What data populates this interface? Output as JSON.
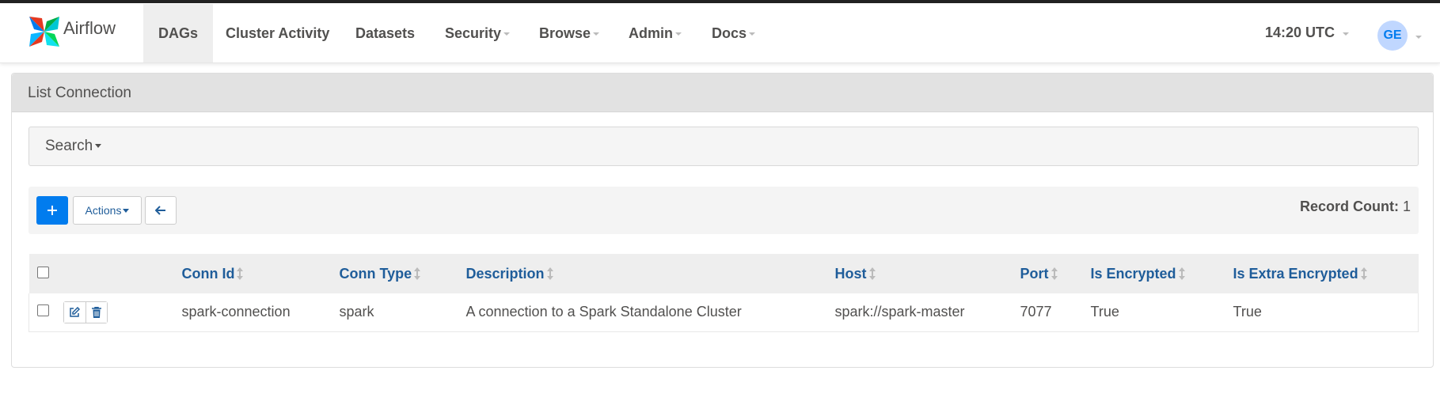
{
  "brand": {
    "name": "Airflow"
  },
  "nav": {
    "items": [
      {
        "label": "DAGs",
        "dropdown": false,
        "active": true
      },
      {
        "label": "Cluster Activity",
        "dropdown": false
      },
      {
        "label": "Datasets",
        "dropdown": false
      },
      {
        "label": "Security",
        "dropdown": true
      },
      {
        "label": "Browse",
        "dropdown": true
      },
      {
        "label": "Admin",
        "dropdown": true
      },
      {
        "label": "Docs",
        "dropdown": true
      }
    ],
    "clock": "14:20 UTC",
    "user_initials": "GE"
  },
  "panel": {
    "title": "List Connection",
    "search_label": "Search",
    "actions_label": "Actions",
    "record_count_label": "Record Count:",
    "record_count": "1"
  },
  "table": {
    "columns": [
      "Conn Id",
      "Conn Type",
      "Description",
      "Host",
      "Port",
      "Is Encrypted",
      "Is Extra Encrypted"
    ],
    "rows": [
      {
        "conn_id": "spark-connection",
        "conn_type": "spark",
        "description": "A connection to a Spark Standalone Cluster",
        "host": "spark://spark-master",
        "port": "7077",
        "is_encrypted": "True",
        "is_extra_encrypted": "True"
      }
    ]
  },
  "colors": {
    "accent": "#017cee",
    "link": "#1f5d9a",
    "text": "#51504f",
    "avatar_bg": "#c0d7ff"
  }
}
